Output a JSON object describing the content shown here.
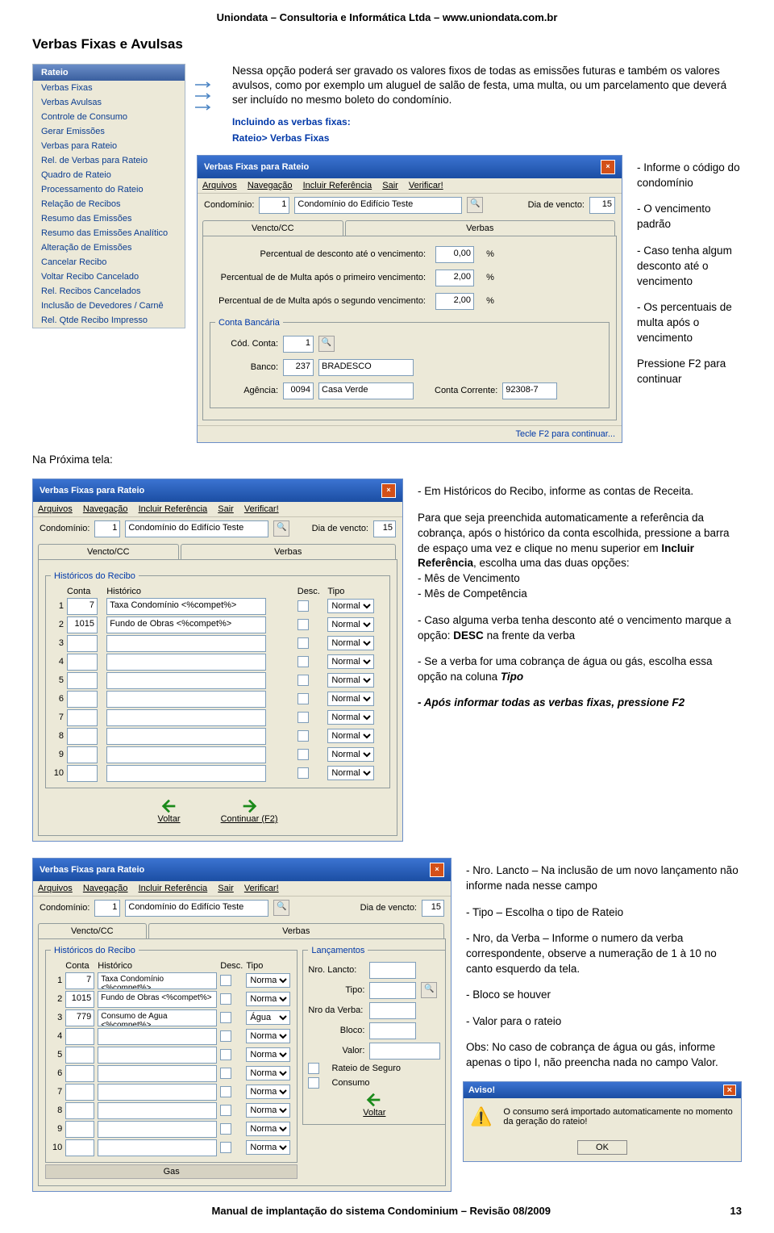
{
  "header": "Uniondata – Consultoria e Informática Ltda – www.uniondata.com.br",
  "title": "Verbas Fixas e Avulsas",
  "nav": {
    "head": "Rateio",
    "items": [
      "Verbas Fixas",
      "Verbas Avulsas",
      "Controle de Consumo",
      "Gerar Emissões",
      "Verbas para Rateio",
      "Rel. de Verbas para Rateio",
      "Quadro de Rateio",
      "Processamento do Rateio",
      "Relação de Recibos",
      "Resumo das Emissões",
      "Resumo das Emissões Analítico",
      "Alteração de Emissões",
      "Cancelar Recibo",
      "Voltar Recibo Cancelado",
      "Rel. Recibos Cancelados",
      "Inclusão de Devedores / Carnê",
      "Rel. Qtde Recibo Impresso"
    ]
  },
  "intro": "Nessa opção poderá ser gravado os valores fixos de todas as emissões futuras e também os valores avulsos, como por exemplo um aluguel de salão de festa, uma multa, ou um parcelamento que deverá ser incluído no mesmo boleto do condomínio.",
  "inc_label": "Incluindo as verbas fixas:",
  "path": "Rateio> Verbas Fixas",
  "win1": {
    "title": "Verbas Fixas para Rateio",
    "menu": [
      "Arquivos",
      "Navegação",
      "Incluir Referência",
      "Sair",
      "Verificar!"
    ],
    "cond_label": "Condomínio:",
    "cond_num": "1",
    "cond_name": "Condomínio do Edifício Teste",
    "vencto_label": "Dia de vencto:",
    "vencto_val": "15",
    "tab1": "Vencto/CC",
    "tab2": "Verbas",
    "f1_label": "Percentual de desconto até o vencimento:",
    "f1_val": "0,00",
    "pct": "%",
    "f2_label": "Percentual de de Multa após o primeiro vencimento:",
    "f2_val": "2,00",
    "f3_label": "Percentual de de Multa após o segundo vencimento:",
    "f3_val": "2,00",
    "fs_title": "Conta Bancária",
    "cod_label": "Cód. Conta:",
    "cod_val": "1",
    "banco_label": "Banco:",
    "banco_num": "237",
    "banco_name": "BRADESCO",
    "ag_label": "Agência:",
    "ag_num": "0094",
    "ag_name": "Casa Verde",
    "cc_label": "Conta Corrente:",
    "cc_val": "92308-7",
    "status": "Tecle F2 para continuar..."
  },
  "notes1": {
    "a": "- Informe o código do condomínio",
    "b": "- O vencimento padrão",
    "c": "- Caso tenha algum desconto até o vencimento",
    "d": "- Os percentuais de multa após o vencimento",
    "e": "Pressione F2 para continuar"
  },
  "proxima": "Na Próxima tela:",
  "win2": {
    "title": "Verbas Fixas para Rateio",
    "fs": "Históricos do Recibo",
    "head_conta": "Conta",
    "head_hist": "Histórico",
    "head_desc": "Desc.",
    "head_tipo": "Tipo",
    "rows": [
      {
        "n": "1",
        "c": "7",
        "h": "Taxa Condomínio <%compet%>",
        "t": "Normal"
      },
      {
        "n": "2",
        "c": "1015",
        "h": "Fundo de Obras <%compet%>",
        "t": "Normal"
      },
      {
        "n": "3",
        "c": "",
        "h": "",
        "t": "Normal"
      },
      {
        "n": "4",
        "c": "",
        "h": "",
        "t": "Normal"
      },
      {
        "n": "5",
        "c": "",
        "h": "",
        "t": "Normal"
      },
      {
        "n": "6",
        "c": "",
        "h": "",
        "t": "Normal"
      },
      {
        "n": "7",
        "c": "",
        "h": "",
        "t": "Normal"
      },
      {
        "n": "8",
        "c": "",
        "h": "",
        "t": "Normal"
      },
      {
        "n": "9",
        "c": "",
        "h": "",
        "t": "Normal"
      },
      {
        "n": "10",
        "c": "",
        "h": "",
        "t": "Normal"
      }
    ],
    "voltar": "Voltar",
    "cont": "Continuar (F2)"
  },
  "notes2": {
    "a": "- Em Históricos do Recibo, informe as contas de Receita.",
    "b1": "Para que seja preenchida automaticamente a referência da cobrança, após o histórico da conta escolhida, pressione a barra de espaço uma vez e clique no menu superior em ",
    "b2": "Incluir Referência",
    "b3": ", escolha uma das duas opções:",
    "c": "- Mês de Vencimento",
    "d": "- Mês de Competência",
    "e1": "- Caso alguma verba tenha desconto até o vencimento marque a opção: ",
    "e2": "DESC",
    "e3": " na frente da verba",
    "f1": "- Se a verba for uma cobrança de água ou gás, escolha essa opção na coluna ",
    "f2": "Tipo",
    "g": "- Após informar todas as verbas fixas, pressione F2"
  },
  "win3": {
    "title": "Verbas Fixas para Rateio",
    "rows": [
      {
        "n": "1",
        "c": "7",
        "h": "Taxa Condomínio <%compet%>",
        "t": "Normal"
      },
      {
        "n": "2",
        "c": "1015",
        "h": "Fundo de Obras <%compet%>",
        "t": "Normal"
      },
      {
        "n": "3",
        "c": "779",
        "h": "Consumo de Agua <%compet%>",
        "t": "Água"
      },
      {
        "n": "4",
        "c": "",
        "h": "",
        "t": "Normal"
      },
      {
        "n": "5",
        "c": "",
        "h": "",
        "t": "Normal"
      },
      {
        "n": "6",
        "c": "",
        "h": "",
        "t": "Normal"
      },
      {
        "n": "7",
        "c": "",
        "h": "",
        "t": "Normal"
      },
      {
        "n": "8",
        "c": "",
        "h": "",
        "t": "Normal"
      },
      {
        "n": "9",
        "c": "",
        "h": "",
        "t": "Normal"
      },
      {
        "n": "10",
        "c": "",
        "h": "",
        "t": "Normal"
      }
    ],
    "gas": "Gas",
    "lanc": "Lançamentos",
    "nro": "Nro. Lancto:",
    "tipo": "Tipo:",
    "nrov": "Nro da Verba:",
    "bloco": "Bloco:",
    "valor": "Valor:",
    "cb1": "Rateio de Seguro",
    "cb2": "Consumo",
    "voltar": "Voltar"
  },
  "notes3": {
    "a": "- Nro. Lancto – Na inclusão de um novo lançamento não informe nada nesse campo",
    "b": "- Tipo – Escolha o tipo de Rateio",
    "c": "- Nro, da Verba – Informe o numero da verba correspondente, observe a numeração de 1 à 10 no canto esquerdo da tela.",
    "d": "- Bloco se houver",
    "e": "- Valor para o rateio",
    "f": "Obs: No caso de cobrança de água ou gás, informe apenas o tipo I, não preencha nada no campo Valor."
  },
  "aviso": {
    "title": "Aviso!",
    "msg": "O consumo será importado automaticamente no momento da geração do rateio!",
    "ok": "OK"
  },
  "footer": "Manual de implantação do sistema Condominium – Revisão 08/2009",
  "page": "13"
}
